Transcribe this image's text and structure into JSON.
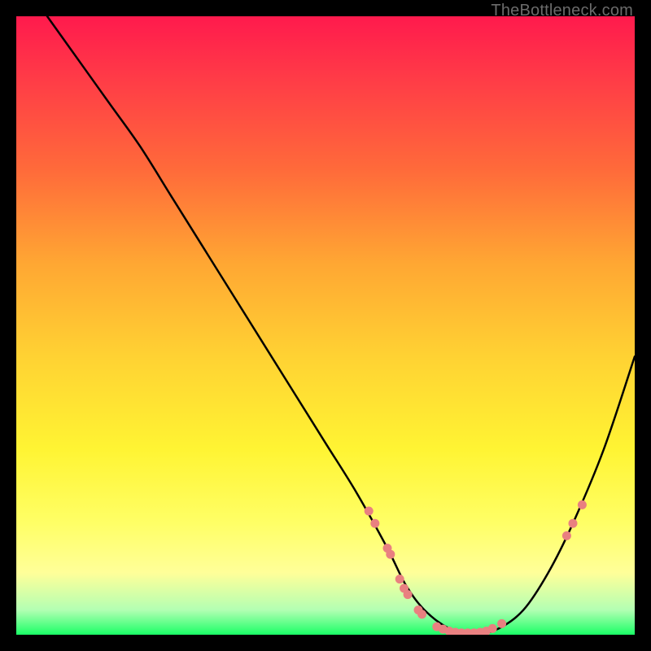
{
  "attribution": "TheBottleneck.com",
  "chart_data": {
    "type": "line",
    "title": "",
    "xlabel": "",
    "ylabel": "",
    "xlim": [
      0,
      100
    ],
    "ylim": [
      0,
      100
    ],
    "series": [
      {
        "name": "curve",
        "x": [
          5,
          10,
          15,
          20,
          25,
          30,
          35,
          40,
          45,
          50,
          55,
          60,
          63,
          66,
          70,
          74,
          78,
          82,
          86,
          90,
          95,
          100
        ],
        "y": [
          100,
          93,
          86,
          79,
          71,
          63,
          55,
          47,
          39,
          31,
          23,
          14,
          8,
          4,
          1,
          0,
          1,
          4,
          10,
          18,
          30,
          45
        ]
      }
    ],
    "markers": [
      {
        "x": 57,
        "y": 20
      },
      {
        "x": 58,
        "y": 18
      },
      {
        "x": 60,
        "y": 14
      },
      {
        "x": 60.5,
        "y": 13
      },
      {
        "x": 62,
        "y": 9
      },
      {
        "x": 62.7,
        "y": 7.5
      },
      {
        "x": 63.3,
        "y": 6.5
      },
      {
        "x": 65,
        "y": 4
      },
      {
        "x": 65.6,
        "y": 3.3
      },
      {
        "x": 68,
        "y": 1.3
      },
      {
        "x": 69,
        "y": 0.9
      },
      {
        "x": 70,
        "y": 0.6
      },
      {
        "x": 71,
        "y": 0.4
      },
      {
        "x": 72,
        "y": 0.3
      },
      {
        "x": 73,
        "y": 0.3
      },
      {
        "x": 74,
        "y": 0.3
      },
      {
        "x": 75,
        "y": 0.4
      },
      {
        "x": 76,
        "y": 0.6
      },
      {
        "x": 77,
        "y": 1.0
      },
      {
        "x": 78.5,
        "y": 1.8
      },
      {
        "x": 89,
        "y": 16
      },
      {
        "x": 90,
        "y": 18
      },
      {
        "x": 91.5,
        "y": 21
      }
    ],
    "marker_color": "#e98080",
    "curve_color": "#000000"
  }
}
